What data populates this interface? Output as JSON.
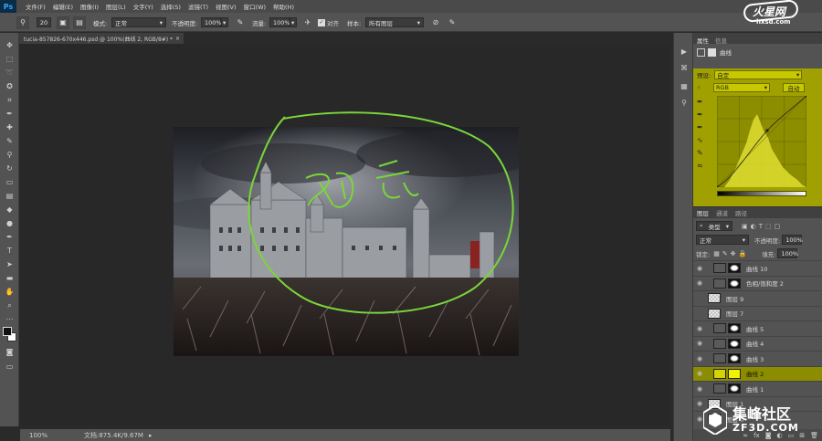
{
  "app": {
    "logo": "Ps"
  },
  "menu": [
    "文件(F)",
    "编辑(E)",
    "图像(I)",
    "图层(L)",
    "文字(Y)",
    "选择(S)",
    "滤镜(T)",
    "视图(V)",
    "窗口(W)",
    "帮助(H)"
  ],
  "options": {
    "brush_size": "20",
    "mode_label": "模式:",
    "mode_value": "正常",
    "opacity_label": "不透明度:",
    "opacity_value": "100%",
    "flow_label": "流量:",
    "flow_value": "100%",
    "align_label": "对齐",
    "sample_label": "样本:",
    "sample_value": "所有图层"
  },
  "document": {
    "tab_title": "tucia-857826-670x446.psd @ 100%(曲线 2, RGB/8#) *",
    "zoom": "100%",
    "doc_status": "文档:875.4K/9.67M"
  },
  "properties": {
    "tab_properties": "属性",
    "tab_info": "信息",
    "panel_title": "曲线",
    "preset_label": "预设:",
    "preset_value": "自定",
    "channel_value": "RGB",
    "auto_button": "自动"
  },
  "layers": {
    "tab_layers": "图层",
    "tab_channels": "通道",
    "tab_paths": "路径",
    "kind_value": "类型",
    "blend_mode": "正常",
    "opacity_label": "不透明度:",
    "opacity_value": "100%",
    "lock_label": "锁定:",
    "fill_label": "填充:",
    "fill_value": "100%",
    "rows": [
      {
        "name": "曲线 10",
        "type": "adjust",
        "selected": false
      },
      {
        "name": "色相/饱和度 2",
        "type": "adjust",
        "selected": false
      },
      {
        "name": "图层 9",
        "type": "pixel",
        "selected": false
      },
      {
        "name": "图层 7",
        "type": "pixel",
        "selected": false
      },
      {
        "name": "曲线 5",
        "type": "adjust",
        "selected": false
      },
      {
        "name": "曲线 4",
        "type": "adjust",
        "selected": false
      },
      {
        "name": "曲线 3",
        "type": "adjust",
        "selected": false
      },
      {
        "name": "曲线 2",
        "type": "adjust",
        "selected": true
      },
      {
        "name": "曲线 1",
        "type": "adjust",
        "selected": false
      },
      {
        "name": "图层 1",
        "type": "pixel",
        "selected": false
      },
      {
        "name": "图层 0",
        "type": "pixel",
        "selected": false
      }
    ]
  },
  "watermark_top": {
    "brand": "火星网",
    "url": "hxsd.com"
  },
  "watermark_bottom": {
    "brand": "集峰社区",
    "url": "ZF3D.COM"
  },
  "colors": {
    "accent_yellow": "#a0a000",
    "ui_dark": "#535353",
    "annotation_green": "#7ad63a"
  }
}
